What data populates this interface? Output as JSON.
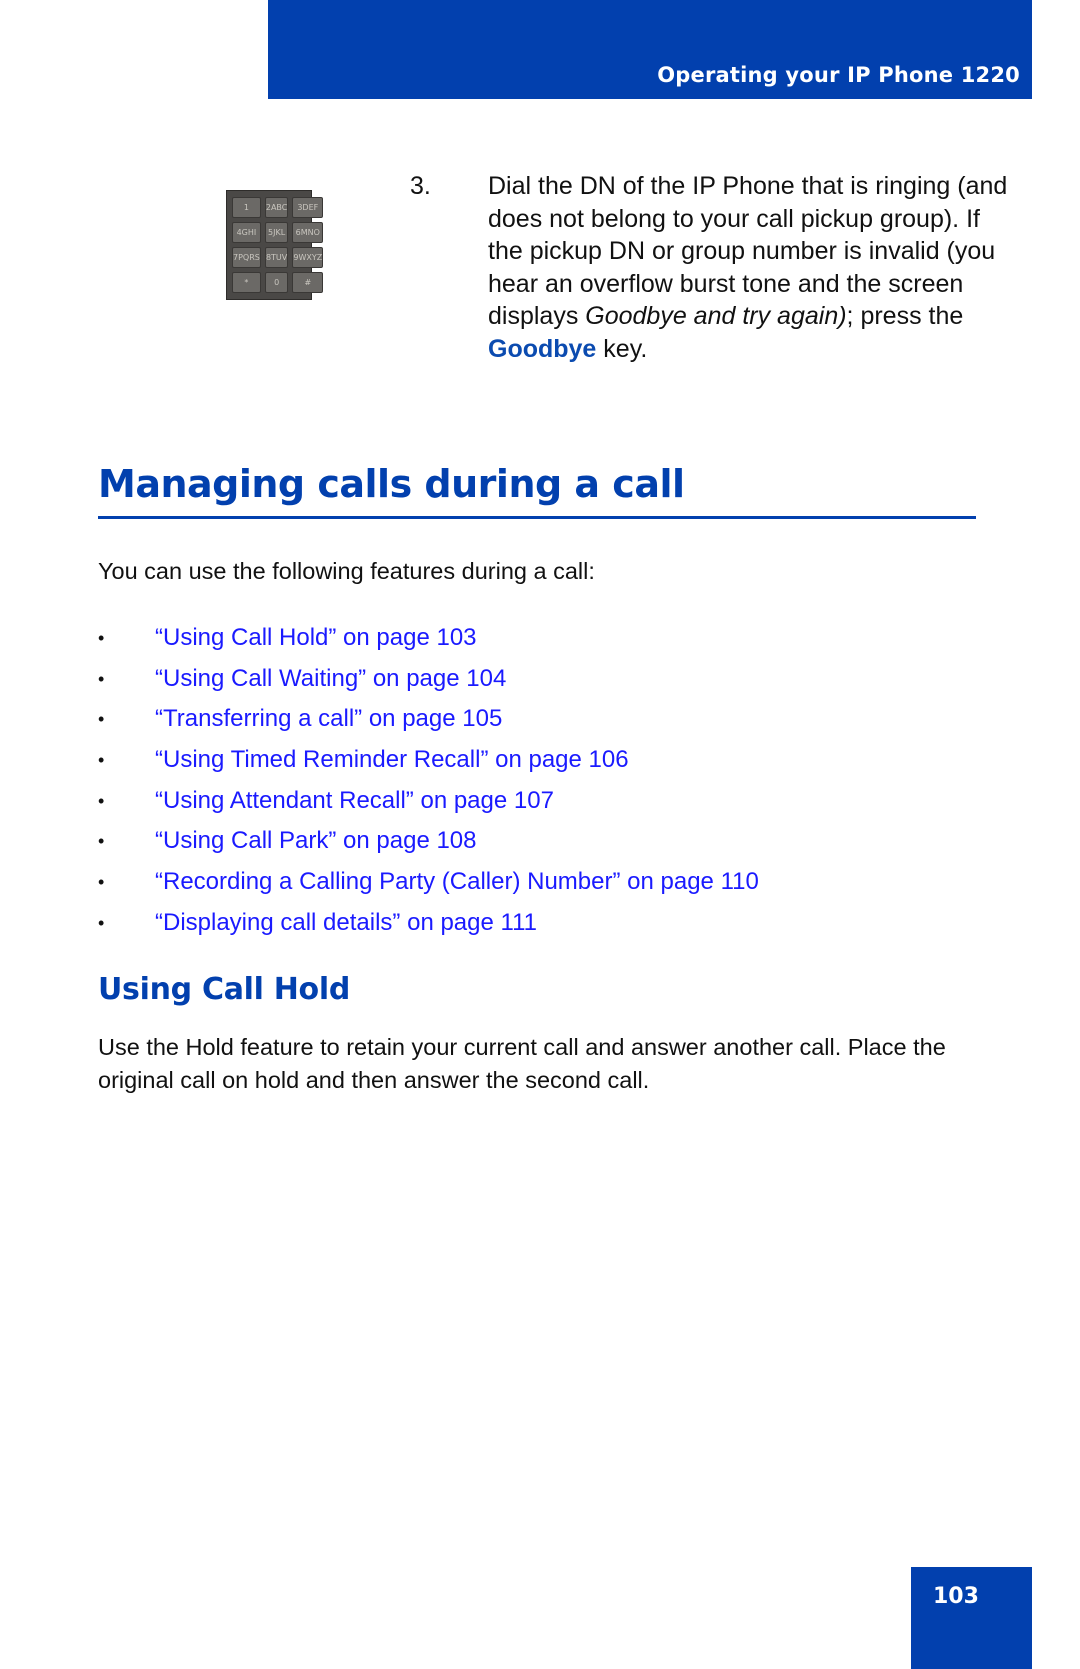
{
  "header": {
    "title": "Operating your IP Phone 1220"
  },
  "keypad": {
    "keys": [
      "1",
      "2ABC",
      "3DEF",
      "4GHI",
      "5JKL",
      "6MNO",
      "7PQRS",
      "8TUV",
      "9WXYZ",
      "*",
      "0",
      "#"
    ]
  },
  "step": {
    "number": "3.",
    "text_before": "Dial the DN of the IP Phone that is ringing (and does not belong to your call pickup group). If the pickup DN or group number is invalid (you hear an overflow burst tone and the screen displays ",
    "italic": "Goodbye and try again)",
    "text_middle": "; press the ",
    "key_label": "Goodbye",
    "text_after": " key."
  },
  "section": {
    "title": "Managing calls during a call",
    "intro": "You can use the following features during a call:",
    "links": [
      "“Using Call Hold” on page 103",
      "“Using Call Waiting” on page 104",
      "“Transferring a call” on page 105",
      "“Using Timed Reminder Recall” on page 106",
      "“Using Attendant Recall” on page 107",
      "“Using Call Park” on page 108",
      "“Recording a Calling Party (Caller) Number” on page 110",
      "“Displaying call details” on page 111"
    ],
    "bullet": "•"
  },
  "subsection": {
    "title": "Using Call Hold",
    "body": "Use the Hold feature to retain your current call and answer another call. Place the original call on hold and then answer the second call."
  },
  "footer": {
    "page_number": "103"
  },
  "colors": {
    "brand_blue": "#0240ae",
    "link_blue": "#1a1aff",
    "key_blue": "#0b4bb0"
  }
}
